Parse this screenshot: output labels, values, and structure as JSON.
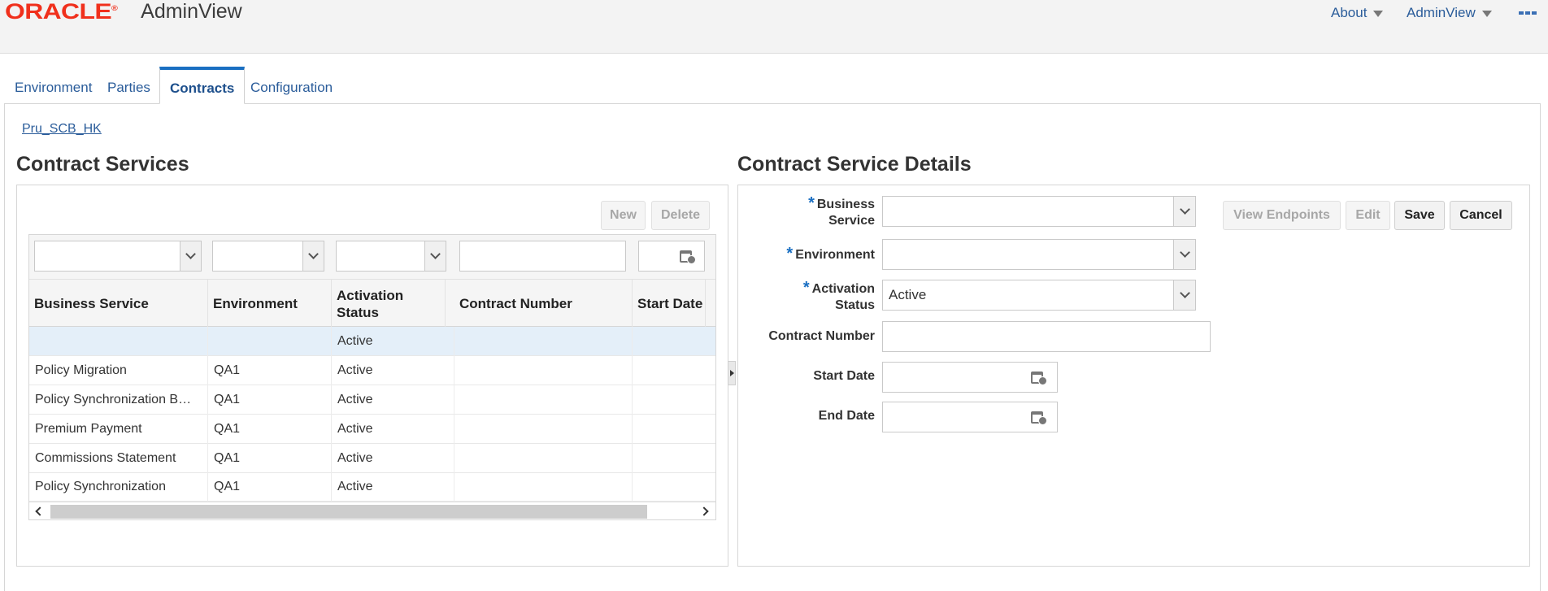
{
  "header": {
    "logo_text": "ORACLE",
    "app_title": "AdminView",
    "menus": [
      {
        "label": "About"
      },
      {
        "label": "AdminView"
      }
    ]
  },
  "tabs": [
    {
      "label": "Environment",
      "active": false
    },
    {
      "label": "Parties",
      "active": false
    },
    {
      "label": "Contracts",
      "active": true
    },
    {
      "label": "Configuration",
      "active": false
    }
  ],
  "breadcrumb": "Pru_SCB_HK",
  "left_panel": {
    "title": "Contract Services",
    "buttons": {
      "new": "New",
      "delete": "Delete"
    },
    "columns": [
      "Business Service",
      "Environment",
      "Activation Status",
      "Contract Number",
      "Start Date"
    ],
    "rows": [
      {
        "business_service": "",
        "environment": "",
        "activation_status": "Active",
        "contract_number": "",
        "start_date": "",
        "selected": true
      },
      {
        "business_service": "Policy Migration",
        "environment": "QA1",
        "activation_status": "Active",
        "contract_number": "",
        "start_date": ""
      },
      {
        "business_service": "Policy Synchronization B…",
        "environment": "QA1",
        "activation_status": "Active",
        "contract_number": "",
        "start_date": ""
      },
      {
        "business_service": "Premium Payment",
        "environment": "QA1",
        "activation_status": "Active",
        "contract_number": "",
        "start_date": ""
      },
      {
        "business_service": "Commissions Statement",
        "environment": "QA1",
        "activation_status": "Active",
        "contract_number": "",
        "start_date": ""
      },
      {
        "business_service": "Policy Synchronization",
        "environment": "QA1",
        "activation_status": "Active",
        "contract_number": "",
        "start_date": ""
      }
    ]
  },
  "right_panel": {
    "title": "Contract Service Details",
    "fields": {
      "business_service": {
        "label": "Business Service",
        "required": "*",
        "value": ""
      },
      "environment": {
        "label": "Environment",
        "required": "*",
        "value": ""
      },
      "activation_status": {
        "label": "Activation Status",
        "required": "*",
        "value": "Active"
      },
      "contract_number": {
        "label": "Contract Number",
        "value": ""
      },
      "start_date": {
        "label": "Start Date",
        "value": ""
      },
      "end_date": {
        "label": "End Date",
        "value": ""
      }
    },
    "buttons": {
      "view_endpoints": "View Endpoints",
      "edit": "Edit",
      "save": "Save",
      "cancel": "Cancel"
    }
  },
  "colors": {
    "accent": "#1a6fc2",
    "link": "#2a5c9a",
    "oracle_red": "#f0301c"
  },
  "icons": [
    "chevron-down-icon",
    "calendar-icon",
    "scroll-left-icon",
    "scroll-right-icon",
    "app-menu-icon"
  ]
}
